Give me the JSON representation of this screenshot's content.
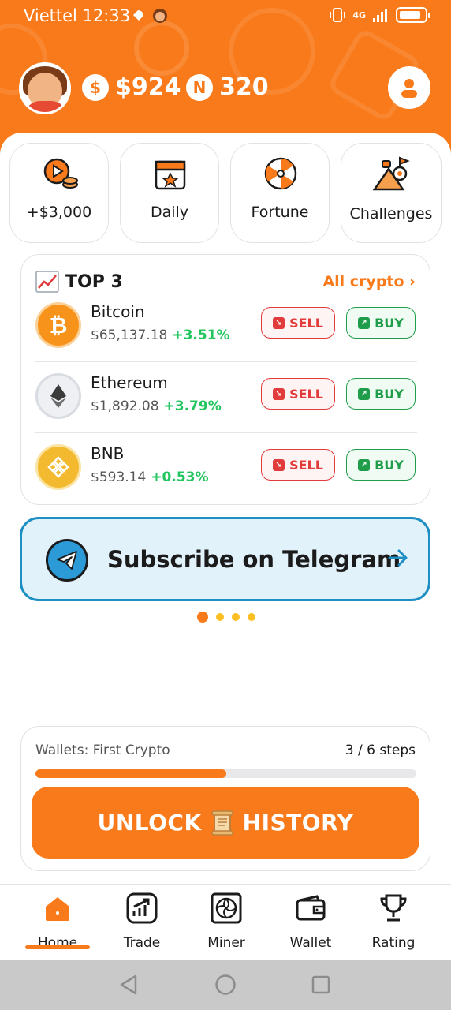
{
  "status_bar": {
    "carrier": "Viettel",
    "time": "12:33",
    "network": "4G"
  },
  "header": {
    "usd_symbol": "$",
    "usd_balance": "$924",
    "n_symbol": "N",
    "n_balance": "320"
  },
  "quick_actions": [
    {
      "label": "+$3,000",
      "icon": "video-coins-icon"
    },
    {
      "label": "Daily",
      "icon": "calendar-star-icon"
    },
    {
      "label": "Fortune",
      "icon": "fortune-wheel-icon"
    },
    {
      "label": "Challenges",
      "icon": "trophy-mountain-icon"
    }
  ],
  "top3": {
    "title": "TOP 3",
    "all_link": "All crypto ›",
    "sell_label": "SELL",
    "buy_label": "BUY",
    "coins": [
      {
        "name": "Bitcoin",
        "price": "$65,137.18",
        "change": "+3.51%",
        "color": "#f7931a",
        "icon": "bitcoin-icon"
      },
      {
        "name": "Ethereum",
        "price": "$1,892.08",
        "change": "+3.79%",
        "color": "#e7e9ee",
        "icon": "ethereum-icon"
      },
      {
        "name": "BNB",
        "price": "$593.14",
        "change": "+0.53%",
        "color": "#f3ba2f",
        "icon": "bnb-icon"
      }
    ]
  },
  "telegram_banner": {
    "text": "Subscribe on Telegram"
  },
  "carousel": {
    "total": 4,
    "active": 0
  },
  "wallet_progress": {
    "label": "Wallets: First Crypto",
    "steps": "3 / 6 steps",
    "progress": 0.5,
    "button_left": "UNLOCK",
    "button_right": "HISTORY"
  },
  "bottom_nav": [
    {
      "label": "Home",
      "active": true
    },
    {
      "label": "Trade",
      "active": false
    },
    {
      "label": "Miner",
      "active": false
    },
    {
      "label": "Wallet",
      "active": false
    },
    {
      "label": "Rating",
      "active": false
    }
  ],
  "colors": {
    "accent": "#f97a1a",
    "green": "#1f9d4a",
    "red": "#e23b3b",
    "telegram": "#1d8fc4"
  }
}
